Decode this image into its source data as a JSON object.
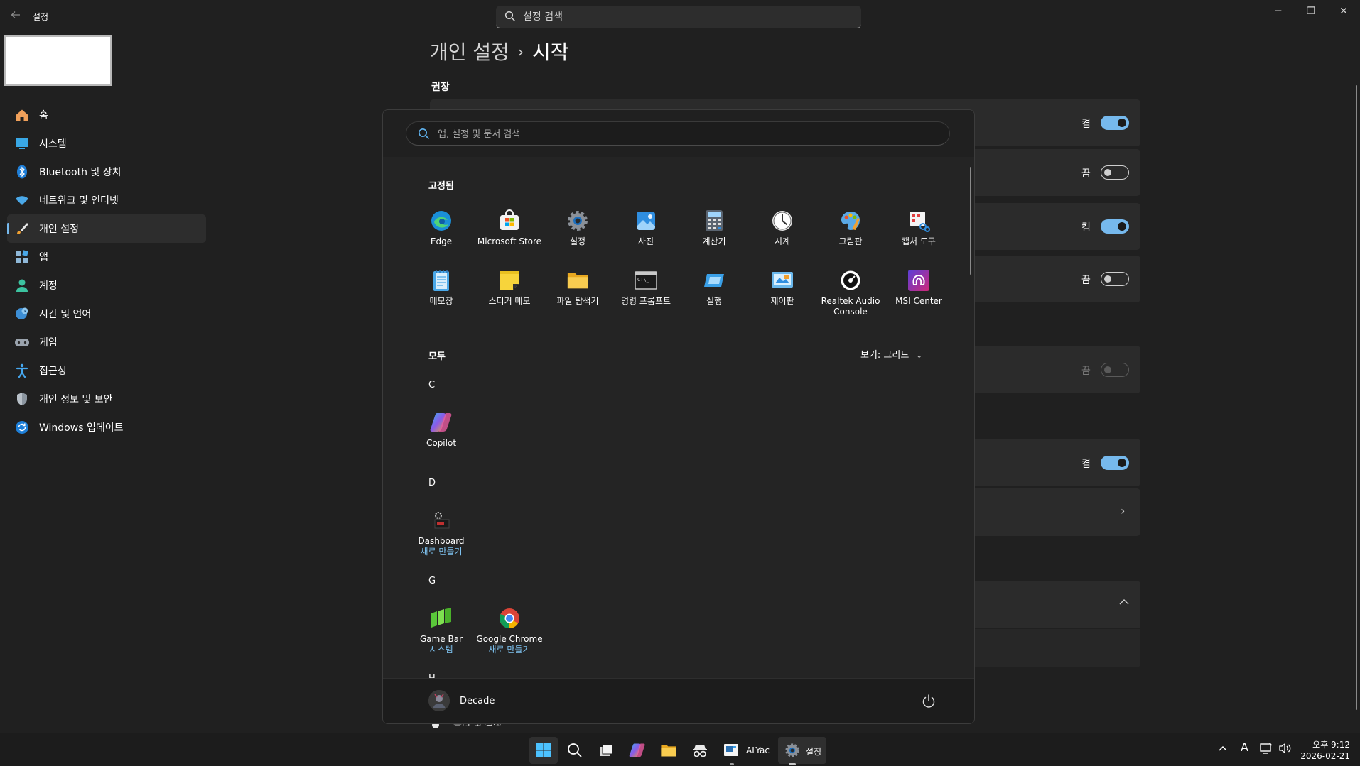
{
  "window": {
    "title": "설정",
    "search_placeholder": "설정 검색",
    "controls": [
      "─",
      "❐",
      "✕"
    ]
  },
  "sidebar": {
    "items": [
      {
        "label": "홈",
        "icon": "home-icon",
        "active": false
      },
      {
        "label": "시스템",
        "icon": "system-icon",
        "active": false
      },
      {
        "label": "Bluetooth 및 장치",
        "icon": "bluetooth-icon",
        "active": false
      },
      {
        "label": "네트워크 및 인터넷",
        "icon": "wifi-icon",
        "active": false
      },
      {
        "label": "개인 설정",
        "icon": "brush-icon",
        "active": true
      },
      {
        "label": "앱",
        "icon": "apps-icon",
        "active": false
      },
      {
        "label": "계정",
        "icon": "account-icon",
        "active": false
      },
      {
        "label": "시간 및 언어",
        "icon": "globe-clock-icon",
        "active": false
      },
      {
        "label": "게임",
        "icon": "gamepad-icon",
        "active": false
      },
      {
        "label": "접근성",
        "icon": "accessibility-icon",
        "active": false
      },
      {
        "label": "개인 정보 및 보안",
        "icon": "shield-icon",
        "active": false
      },
      {
        "label": "Windows 업데이트",
        "icon": "update-icon",
        "active": false
      }
    ]
  },
  "main": {
    "breadcrumb": {
      "parent": "개인 설정",
      "separator": "›",
      "current": "시작"
    },
    "section_label": "권장",
    "rows": [
      {
        "state": "켬",
        "toggle": "on"
      },
      {
        "state": "끔",
        "toggle": "off"
      },
      {
        "state": "켬",
        "toggle": "on"
      },
      {
        "state": "끔",
        "toggle": "off"
      },
      {
        "state": "끔",
        "toggle": "disabled"
      },
      {
        "state": "켬",
        "toggle": "on"
      }
    ],
    "partial_text": "폴더 및 설정"
  },
  "start_menu": {
    "search_placeholder": "앱, 설정 및 문서 검색",
    "pinned_header": "고정됨",
    "pinned": [
      {
        "label": "Edge",
        "icon": "edge-icon"
      },
      {
        "label": "Microsoft Store",
        "icon": "store-icon"
      },
      {
        "label": "설정",
        "icon": "settings-gear-icon"
      },
      {
        "label": "사진",
        "icon": "photos-icon"
      },
      {
        "label": "계산기",
        "icon": "calculator-icon"
      },
      {
        "label": "시계",
        "icon": "clock-icon"
      },
      {
        "label": "그림판",
        "icon": "paint-icon"
      },
      {
        "label": "캡처 도구",
        "icon": "snipping-tool-icon"
      },
      {
        "label": "메모장",
        "icon": "notepad-icon"
      },
      {
        "label": "스티커 메모",
        "icon": "sticky-notes-icon"
      },
      {
        "label": "파일 탐색기",
        "icon": "folder-icon"
      },
      {
        "label": "명령 프롬프트",
        "icon": "terminal-icon"
      },
      {
        "label": "실행",
        "icon": "run-icon"
      },
      {
        "label": "제어판",
        "icon": "control-panel-icon"
      },
      {
        "label": "Realtek Audio Console",
        "line1": "Realtek Audio",
        "line2": "Console",
        "icon": "realtek-icon"
      },
      {
        "label": "MSI Center",
        "icon": "msi-center-icon"
      }
    ],
    "all_header": "모두",
    "view_label": "보기: 그리드",
    "groups": [
      {
        "letter": "C",
        "apps": [
          {
            "label": "Copilot",
            "sub": "",
            "icon": "copilot-icon"
          }
        ]
      },
      {
        "letter": "D",
        "apps": [
          {
            "label": "Dashboard",
            "sub": "새로 만들기",
            "icon": "dashboard-icon"
          }
        ]
      },
      {
        "letter": "G",
        "apps": [
          {
            "label": "Game Bar",
            "sub": "시스템",
            "icon": "game-bar-icon"
          },
          {
            "label": "Google Chrome",
            "sub": "새로 만들기",
            "icon": "chrome-icon"
          }
        ]
      },
      {
        "letter": "H",
        "apps": []
      }
    ],
    "user_name": "Decade"
  },
  "taskbar": {
    "alyac_label": "ALYac",
    "settings_label": "설정",
    "clock": {
      "time": "오후 9:12",
      "date": "2026-02-21"
    },
    "ime": "A"
  },
  "colors": {
    "accent": "#76b9ed",
    "background": "#202020",
    "card": "#2b2b2b",
    "start_bg": "#242424"
  }
}
